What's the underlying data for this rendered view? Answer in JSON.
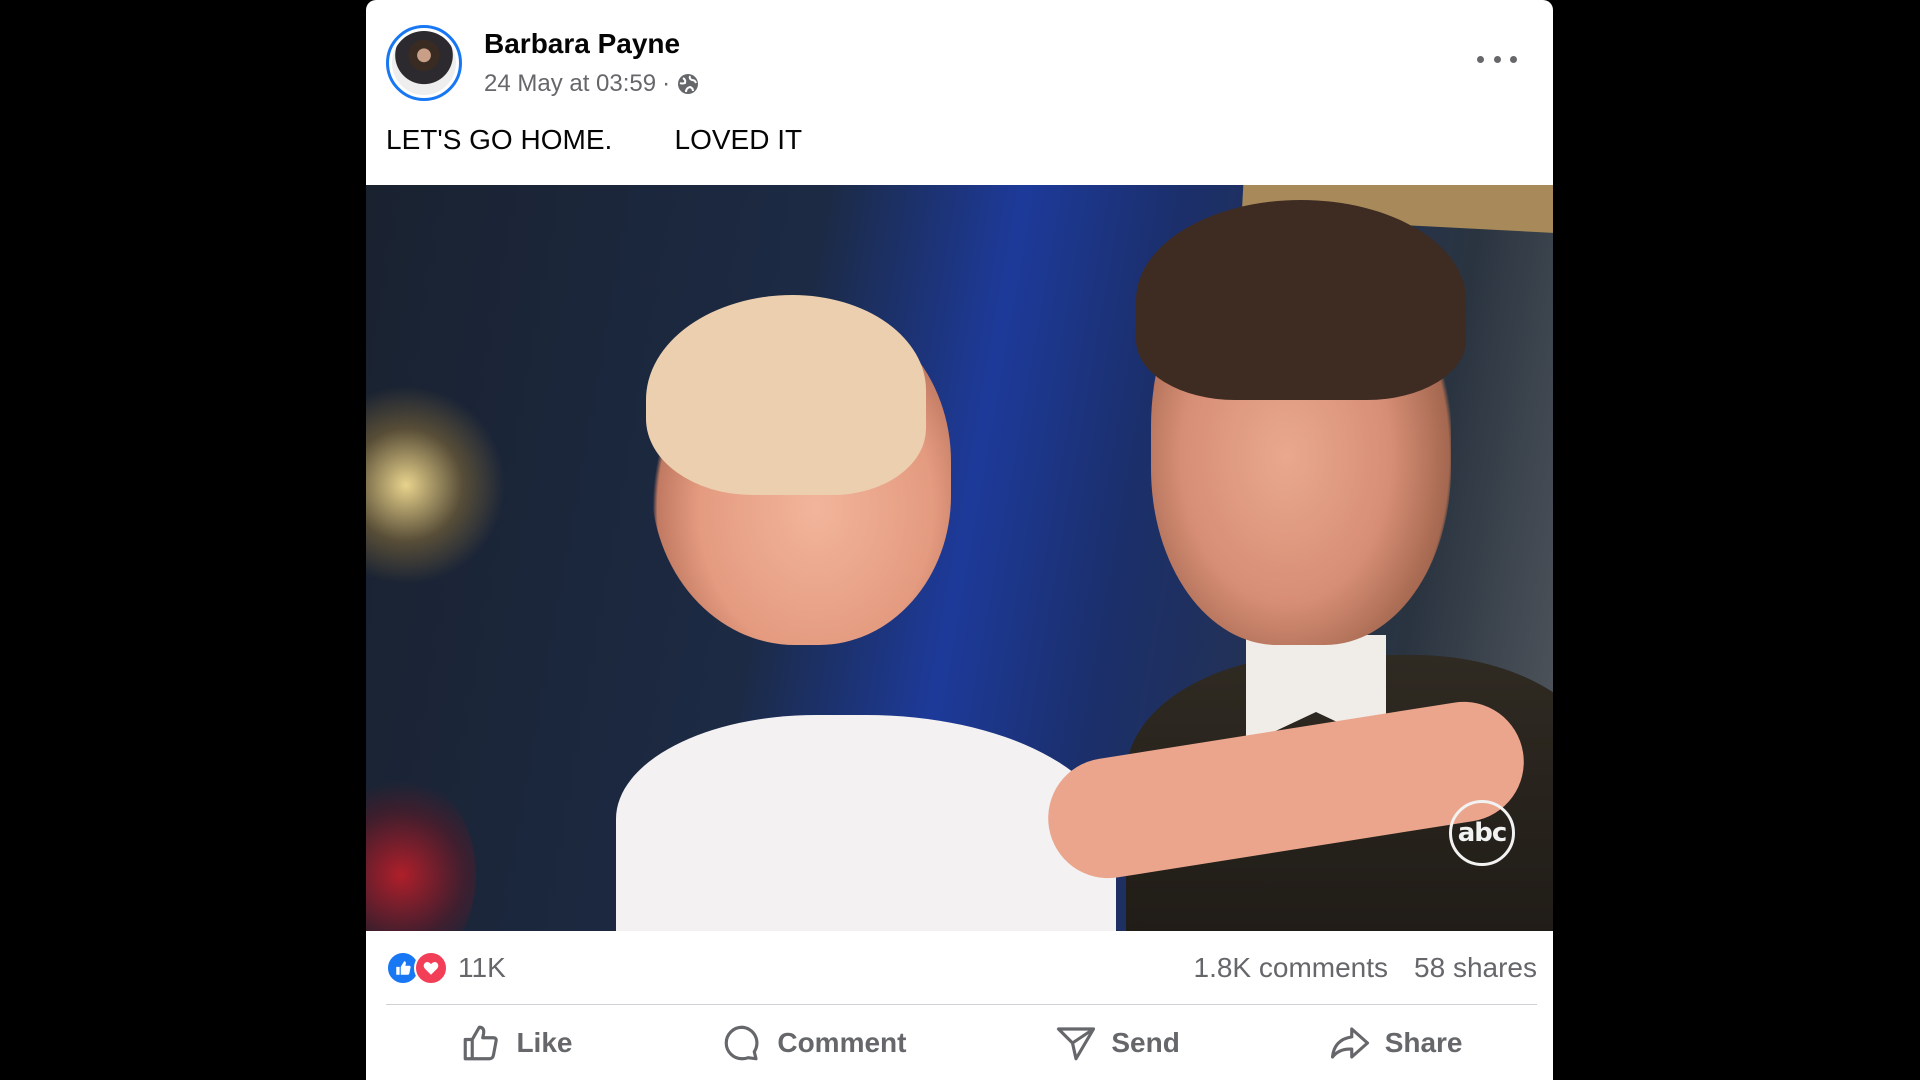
{
  "post": {
    "author": "Barbara Payne",
    "timestamp": "24 May at 03:59",
    "separator": "·",
    "audience_icon": "globe-icon",
    "more_icon": "more-options-icon",
    "caption": "LET'S GO HOME.        LOVED IT"
  },
  "photo": {
    "watermark": "abc"
  },
  "stats": {
    "reaction_icons": [
      "like-reaction-icon",
      "love-reaction-icon"
    ],
    "reaction_count": "11K",
    "comments": "1.8K comments",
    "shares": "58 shares"
  },
  "actions": {
    "like": "Like",
    "comment": "Comment",
    "send": "Send",
    "share": "Share"
  },
  "colors": {
    "accent": "#1877f2",
    "love": "#f33e58",
    "secondary_text": "#65676b"
  }
}
